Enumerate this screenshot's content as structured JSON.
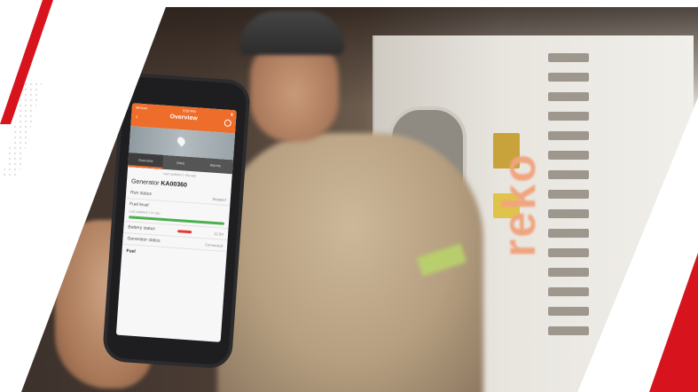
{
  "scene": {
    "description_hidden": "",
    "accent_color": "#d7141d",
    "app_color": "#ee6d2a"
  },
  "phone_app": {
    "status_left": "Verizon",
    "status_center": "3:58 PM",
    "back_label": "Back",
    "title": "Overview",
    "tabs": [
      "Overview",
      "Data",
      "Alarms"
    ],
    "updated": "Last updated 1 day ago",
    "generator_prefix": "Generator",
    "generator_id": "KA00360",
    "rows": [
      {
        "label": "Run status",
        "value": "Stopped"
      },
      {
        "label": "Fuel level",
        "value": ""
      },
      {
        "label": "Battery status",
        "value": "12.0V"
      },
      {
        "label": "Generator status",
        "value": "Connected"
      }
    ],
    "fuel_note": "Last updated 1 hr ago",
    "section": "Fuel"
  },
  "generator": {
    "brand_text": "reko"
  }
}
